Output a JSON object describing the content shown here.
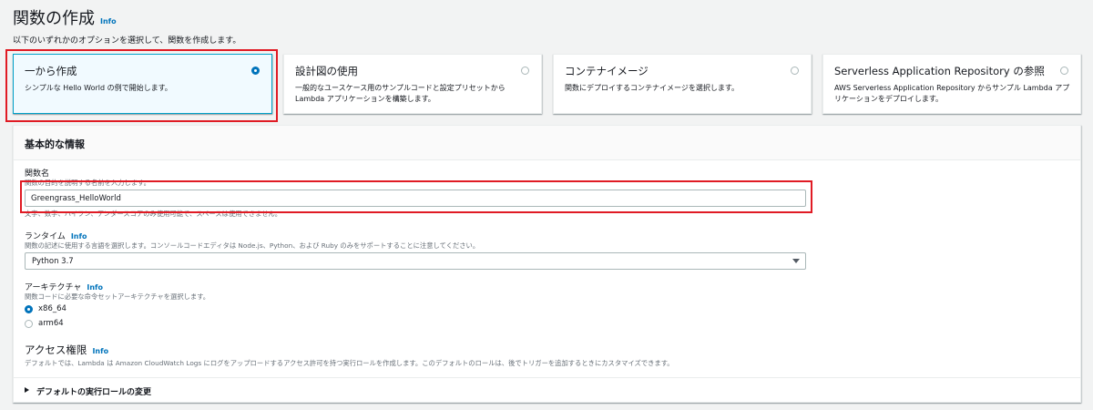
{
  "page": {
    "title": "関数の作成",
    "info_label": "Info",
    "subtitle": "以下のいずれかのオプションを選択して、関数を作成します。"
  },
  "options": [
    {
      "title": "一から作成",
      "description": "シンプルな Hello World の例で開始します。",
      "selected": true
    },
    {
      "title": "設計図の使用",
      "description": "一般的なユースケース用のサンプルコードと設定プリセットから Lambda アプリケーションを構築します。",
      "selected": false
    },
    {
      "title": "コンテナイメージ",
      "description": "関数にデプロイするコンテナイメージを選択します。",
      "selected": false
    },
    {
      "title": "Serverless Application Repository の参照",
      "description": "AWS Serverless Application Repository からサンプル Lambda アプリケーションをデプロイします。",
      "selected": false
    }
  ],
  "basic_info": {
    "header": "基本的な情報",
    "function_name": {
      "label": "関数名",
      "description": "関数の目的を説明する名前を入力します。",
      "value": "Greengrass_HelloWorld",
      "constraint": "文字、数字、ハイフン、アンダースコアのみ使用可能で、スペースは使用できません。"
    },
    "runtime": {
      "label": "ランタイム",
      "info_label": "Info",
      "description": "関数の記述に使用する言語を選択します。コンソールコードエディタは Node.js、Python、および Ruby のみをサポートすることに注意してください。",
      "selected": "Python 3.7"
    },
    "architecture": {
      "label": "アーキテクチャ",
      "info_label": "Info",
      "description": "関数コードに必要な命令セットアーキテクチャを選択します。",
      "options": [
        {
          "label": "x86_64",
          "checked": true
        },
        {
          "label": "arm64",
          "checked": false
        }
      ]
    },
    "permissions": {
      "title": "アクセス権限",
      "info_label": "Info",
      "description": "デフォルトでは、Lambda は Amazon CloudWatch Logs にログをアップロードするアクセス許可を持つ実行ロールを作成します。このデフォルトのロールは、後でトリガーを追加するときにカスタマイズできます。"
    },
    "expander_label": "デフォルトの実行ロールの変更"
  },
  "colors": {
    "highlight": "#e01b24",
    "accent": "#0073bb",
    "selected_card_bg": "#f1faff"
  }
}
